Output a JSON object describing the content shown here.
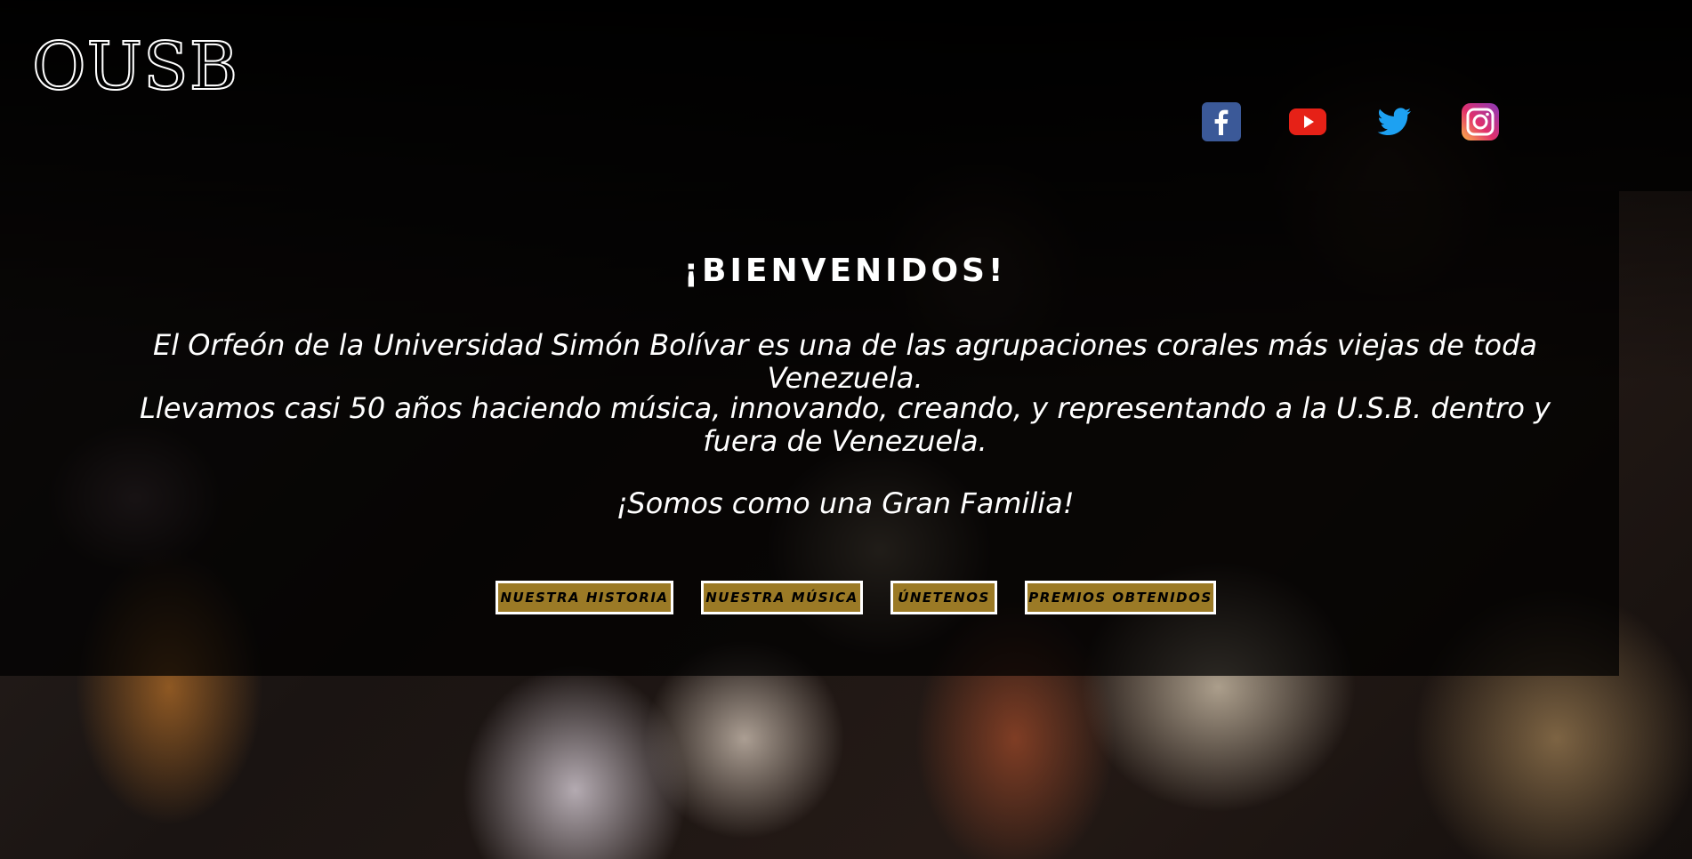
{
  "header": {
    "logo_text": "OUSB"
  },
  "social": [
    {
      "name": "facebook-icon",
      "color": "#3b5998"
    },
    {
      "name": "youtube-icon",
      "color": "#e62117"
    },
    {
      "name": "twitter-icon",
      "color": "#1da1f2"
    },
    {
      "name": "instagram-icon",
      "color": "#8a3ab9"
    }
  ],
  "hero": {
    "title": "¡BIENVENIDOS!",
    "paragraph1": "El Orfeón de la Universidad Simón Bolívar es una de las agrupaciones corales más viejas de toda Venezuela.",
    "paragraph2": "Llevamos casi 50 años haciendo música, innovando, creando, y representando a la U.S.B. dentro y fuera de Venezuela.",
    "paragraph3": "¡Somos como una Gran Familia!"
  },
  "buttons": {
    "history": "NUESTRA HISTORIA",
    "music": "NUESTRA MÚSICA",
    "join": "ÚNETENOS",
    "awards": "PREMIOS OBTENIDOS"
  },
  "colors": {
    "button_bg": "#9b7a26",
    "button_border": "#ffffff"
  }
}
